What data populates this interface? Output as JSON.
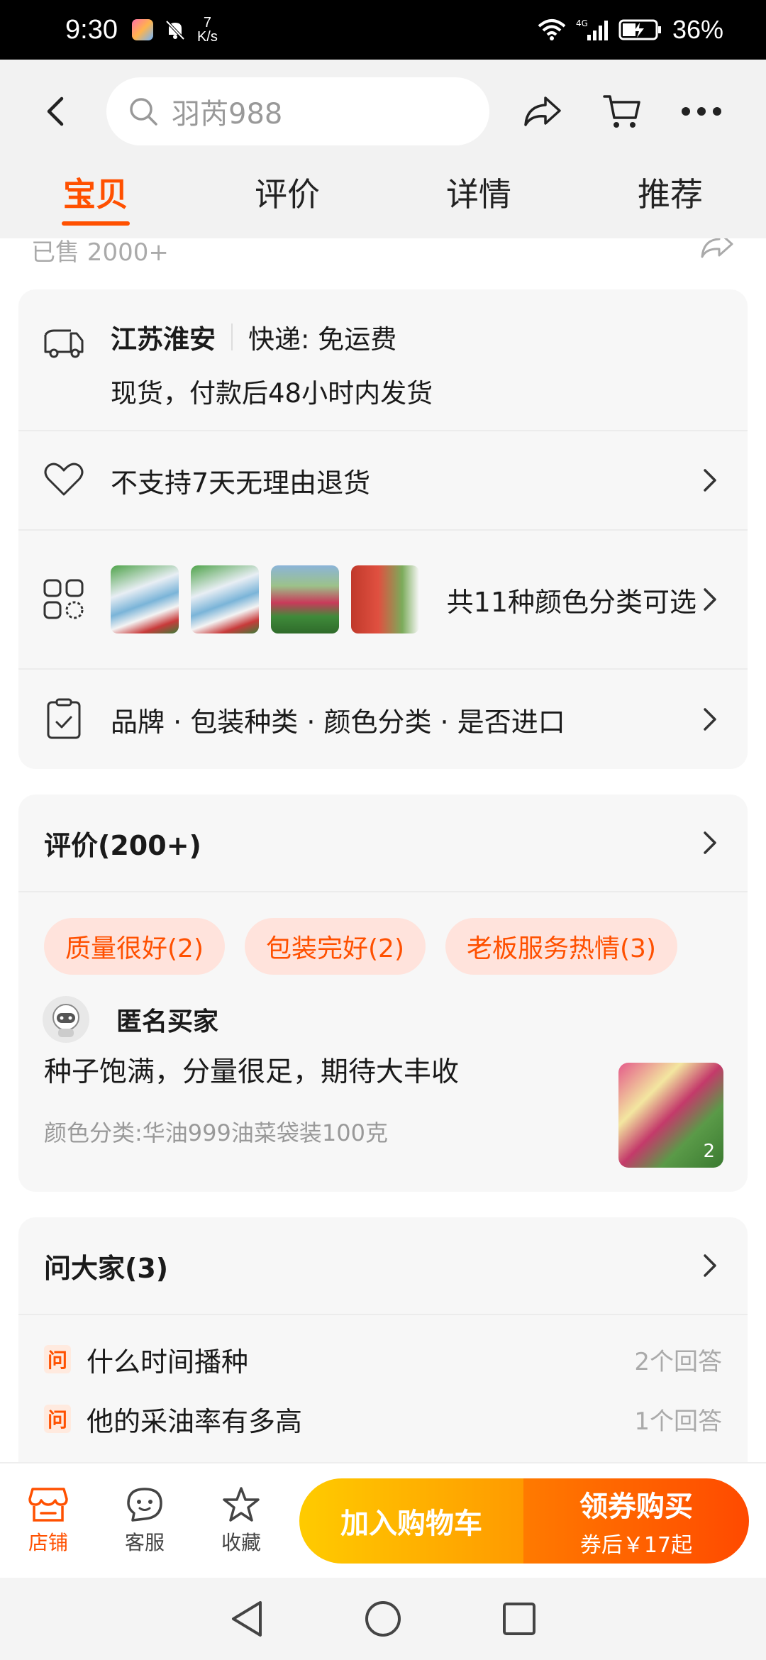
{
  "status_bar": {
    "time": "9:30",
    "net_speed_value": "7",
    "net_speed_unit": "K/s",
    "network": "4G",
    "battery": "36%"
  },
  "header": {
    "search_text": "羽芮988",
    "tabs": [
      "宝贝",
      "评价",
      "详情",
      "推荐"
    ],
    "active_tab": 0
  },
  "sold": "已售 2000+",
  "info": {
    "ship_location": "江苏淮安",
    "ship_fee": "快递: 免运费",
    "ship_time": "现货，付款后48小时内发货",
    "returns": "不支持7天无理由退货",
    "colors": "共11种颜色分类可选",
    "params": "品牌 · 包装种类 · 颜色分类 · 是否进口"
  },
  "reviews": {
    "title": "评价(200+)",
    "tags": [
      "质量很好(2)",
      "包装完好(2)",
      "老板服务热情(3)"
    ],
    "reviewer": "匿名买家",
    "text": "种子饱满，分量很足，期待大丰收",
    "sku": "颜色分类:华油999油菜袋装100克",
    "image_count": "2"
  },
  "qa": {
    "title": "问大家(3)",
    "badge": "问",
    "items": [
      {
        "q": "什么时间播种",
        "count": "2个回答"
      },
      {
        "q": "他的采油率有多高",
        "count": "1个回答"
      }
    ]
  },
  "actions": {
    "store": "店铺",
    "service": "客服",
    "favorite": "收藏",
    "add_cart": "加入购物车",
    "buy": "领券购买",
    "buy_sub": "券后￥17起"
  },
  "colors": {
    "accent": "#ff5000",
    "tag_bg": "#ffe3dc"
  }
}
